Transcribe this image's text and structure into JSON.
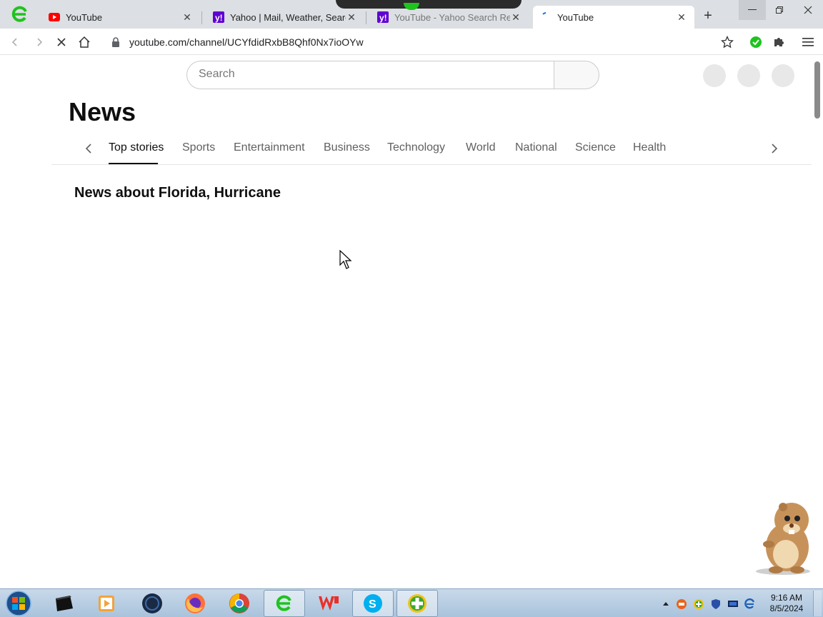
{
  "browser": {
    "tabs": [
      {
        "title": "YouTube",
        "favicon": "youtube-icon",
        "active": false
      },
      {
        "title": "Yahoo | Mail, Weather, Search",
        "favicon": "yahoo-icon",
        "active": false
      },
      {
        "title": "YouTube - Yahoo Search Results",
        "favicon": "yahoo-icon",
        "active": false
      },
      {
        "title": "YouTube",
        "favicon": "loading-icon",
        "active": true
      }
    ],
    "url": "youtube.com/channel/UCYfdidRxbB8Qhf0Nx7ioOYw"
  },
  "page": {
    "search_placeholder": "Search",
    "title": "News",
    "tabs": [
      "Top stories",
      "Sports",
      "Entertainment",
      "Business",
      "Technology",
      "World",
      "National",
      "Science",
      "Health"
    ],
    "active_tab": "Top stories",
    "section_heading": "News about Florida, Hurricane"
  },
  "taskbar": {
    "apps": [
      "black-box-app-icon",
      "media-player-icon",
      "dark-globe-icon",
      "firefox-icon",
      "chrome-icon",
      "e-browser-icon",
      "wps-office-icon",
      "skype-icon",
      "green-plus-app-icon"
    ],
    "time": "9:16 AM",
    "date": "8/5/2024"
  },
  "colors": {
    "tabstrip": "#dcdfe3",
    "accent_green": "#1ec31e",
    "youtube_red": "#ff0000",
    "yahoo_purple": "#6001d2",
    "taskbar": "#b8cde2"
  }
}
